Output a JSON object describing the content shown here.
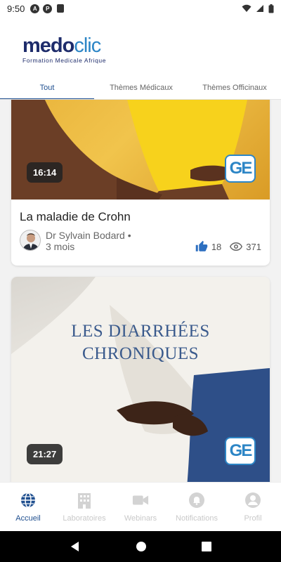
{
  "status_bar": {
    "time": "9:50"
  },
  "brand": {
    "name_part1": "medo",
    "name_part2": "clic",
    "tagline": "Formation Medicale Afrique"
  },
  "tabs": [
    {
      "label": "Tout",
      "active": true
    },
    {
      "label": "Thèmes Médicaux",
      "active": false
    },
    {
      "label": "Thèmes Officinaux",
      "active": false
    }
  ],
  "videos": [
    {
      "title": "La maladie de Crohn",
      "duration": "16:14",
      "author_name": "Dr Sylvain  Bodard •",
      "age": "3 mois",
      "likes": "18",
      "views": "371",
      "badge": "GE"
    },
    {
      "overlay_line1": "LES DIARRHÉES",
      "overlay_line2": "CHRONIQUES",
      "duration": "21:27",
      "badge": "GE"
    }
  ],
  "bottom_nav": [
    {
      "label": "Accueil",
      "icon": "globe-icon",
      "active": true
    },
    {
      "label": "Laboratoires",
      "icon": "building-icon",
      "active": false
    },
    {
      "label": "Webinars",
      "icon": "video-camera-icon",
      "active": false
    },
    {
      "label": "Notifications",
      "icon": "bell-icon",
      "active": false
    },
    {
      "label": "Profil",
      "icon": "user-icon",
      "active": false
    }
  ],
  "colors": {
    "brand_dark": "#1e2c6b",
    "brand_light": "#2d86c6",
    "active_tab": "#1f4f8f",
    "inactive_nav": "#c9c9c9"
  }
}
